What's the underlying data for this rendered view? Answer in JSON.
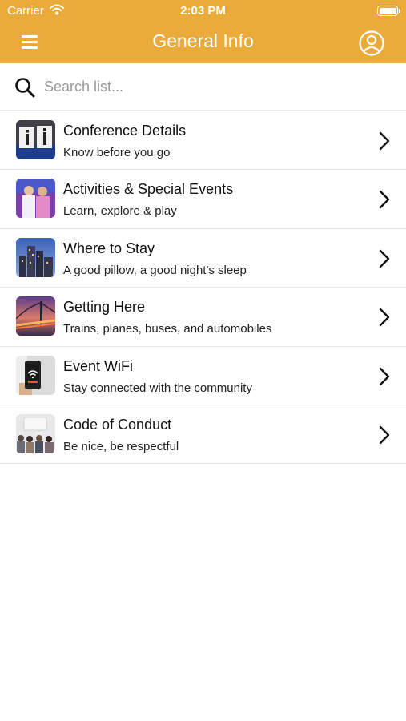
{
  "status_bar": {
    "carrier": "Carrier",
    "time": "2:03 PM"
  },
  "header": {
    "title": "General Info"
  },
  "colors": {
    "accent": "#EBAB3A"
  },
  "search": {
    "placeholder": "Search list..."
  },
  "items": [
    {
      "title": "Conference Details",
      "subtitle": "Know before you go",
      "thumb": "info-sign-thumbnail"
    },
    {
      "title": "Activities & Special Events",
      "subtitle": "Learn, explore & play",
      "thumb": "people-photo-thumbnail"
    },
    {
      "title": "Where to Stay",
      "subtitle": "A good pillow, a good night's sleep",
      "thumb": "city-skyline-thumbnail"
    },
    {
      "title": "Getting Here",
      "subtitle": "Trains, planes, buses, and automobiles",
      "thumb": "bridge-sunset-thumbnail"
    },
    {
      "title": "Event WiFi",
      "subtitle": "Stay connected with the community",
      "thumb": "wifi-phone-thumbnail"
    },
    {
      "title": "Code of Conduct",
      "subtitle": "Be nice, be respectful",
      "thumb": "audience-thumbnail"
    }
  ]
}
